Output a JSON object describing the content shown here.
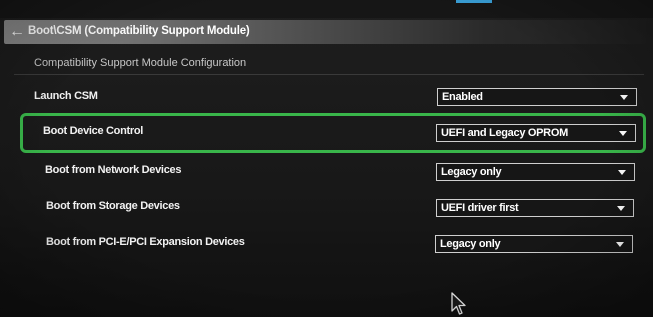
{
  "breadcrumb": {
    "back_icon": "arrow-left-icon",
    "text": "Boot\\CSM (Compatibility Support Module)"
  },
  "section": {
    "header": "Compatibility Support Module Configuration"
  },
  "settings": [
    {
      "label": "Launch CSM",
      "value": "Enabled"
    },
    {
      "label": "Boot Device Control",
      "value": "UEFI and Legacy OPROM",
      "highlighted": true
    },
    {
      "label": "Boot from Network Devices",
      "value": "Legacy only"
    },
    {
      "label": "Boot from Storage Devices",
      "value": "UEFI driver first"
    },
    {
      "label": "Boot from PCI-E/PCI Expansion Devices",
      "value": "Legacy only"
    }
  ],
  "colors": {
    "highlight_border": "#39b54a",
    "accent": "#3aa0d8",
    "background": "#1b1b1b"
  },
  "icons": {
    "dropdown": "caret-down-icon",
    "cursor": "mouse-pointer-icon"
  }
}
